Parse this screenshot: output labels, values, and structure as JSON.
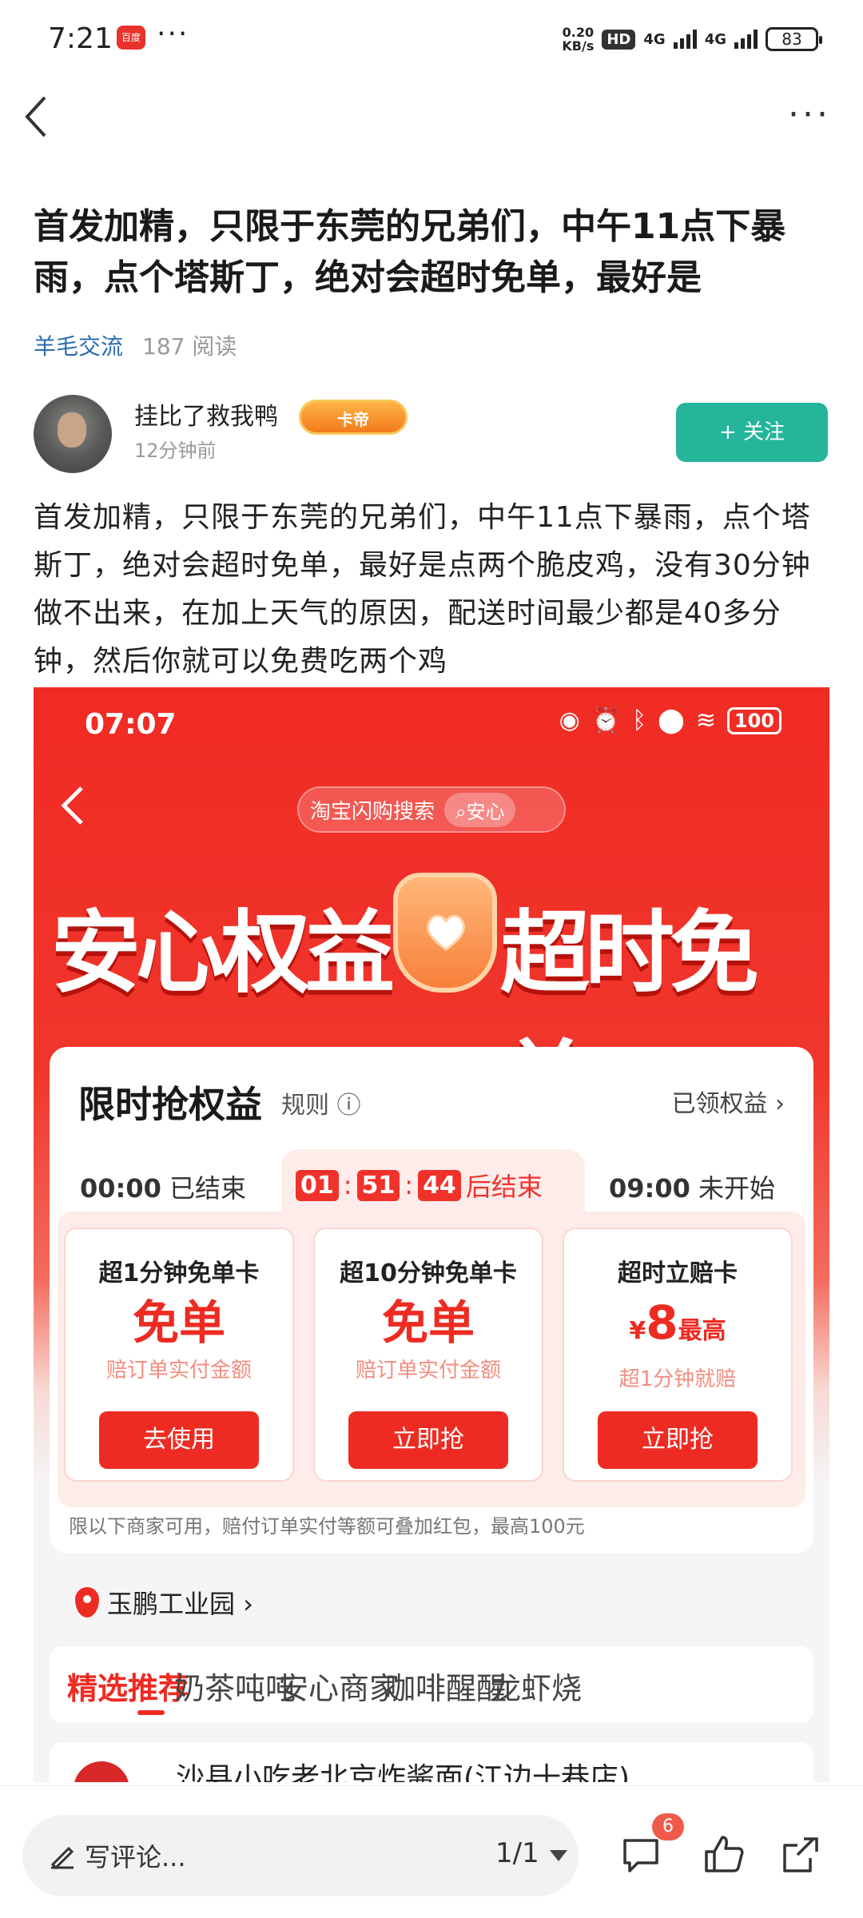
{
  "status_bar": {
    "time": "7:21",
    "app_badge": "百度",
    "more_dots": "···",
    "net_speed_top": "0.20",
    "net_speed_bottom": "KB/s",
    "hd_label": "HD",
    "sig1": "4G",
    "sig2": "4G",
    "battery": "83"
  },
  "nav": {
    "more": "···"
  },
  "post": {
    "title": "首发加精，只限于东莞的兄弟们，中午11点下暴雨，点个塔斯丁，绝对会超时免单，最好是",
    "category": "羊毛交流",
    "views": "187 阅读",
    "author": "挂比了救我鸭",
    "author_badge": "卡帝",
    "time_ago": "12分钟前",
    "follow_label": "+ 关注",
    "body": "首发加精，只限于东莞的兄弟们，中午11点下暴雨，点个塔斯丁，绝对会超时免单，最好是点两个脆皮鸡，没有30分钟做不出来，在加上天气的原因，配送时间最少都是40多分钟，然后你就可以免费吃两个鸡"
  },
  "screenshot": {
    "time": "07:07",
    "battery": "100",
    "search_text": "淘宝闪购搜索",
    "search_btn": "安心",
    "hero_left": "安心权益",
    "hero_right": "超时免单",
    "card_title": "限时抢权益",
    "rule": "规则 ⓘ",
    "claimed": "已领权益 ›",
    "tab_left_time": "00:00",
    "tab_left_status": "已结束",
    "timer_h": "01",
    "timer_m": "51",
    "timer_s": "44",
    "timer_suffix": "后结束",
    "tab_right_time": "09:00",
    "tab_right_status": "未开始",
    "coupons": [
      {
        "name": "超1分钟免单卡",
        "value": "免单",
        "sub": "赔订单实付金额",
        "btn": "去使用"
      },
      {
        "name": "超10分钟免单卡",
        "value": "免单",
        "sub": "赔订单实付金额",
        "btn": "立即抢"
      },
      {
        "name": "超时立赔卡",
        "currency": "¥",
        "amount": "8",
        "suffix": "最高",
        "sub": "超1分钟就赔",
        "btn": "立即抢"
      }
    ],
    "note": "限以下商家可用，赔付订单实付等额可叠加红包，最高100元",
    "location": "玉鹏工业园 ›",
    "categories": [
      "精选推荐",
      "奶茶吨吨",
      "安心商家",
      "咖啡醒醒",
      "龙虾烧"
    ],
    "shop_name": "沙县小吃老北京炸酱面(江边十巷店)"
  },
  "bottom": {
    "comment_placeholder": "写评论...",
    "page": "1/1",
    "comment_count": "6"
  }
}
